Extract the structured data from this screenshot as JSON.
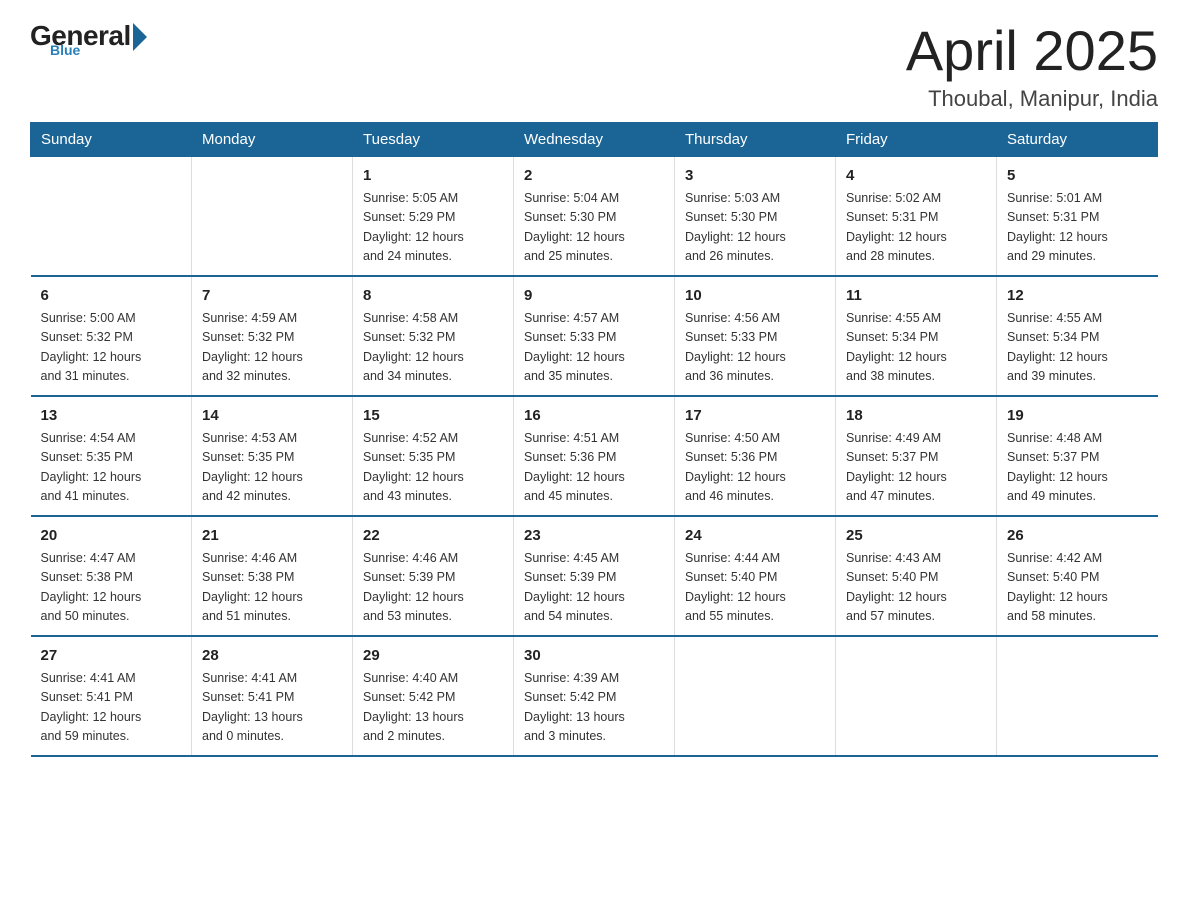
{
  "logo": {
    "general": "General",
    "blue": "Blue",
    "tagline": "Blue"
  },
  "title": "April 2025",
  "subtitle": "Thoubal, Manipur, India",
  "header_days": [
    "Sunday",
    "Monday",
    "Tuesday",
    "Wednesday",
    "Thursday",
    "Friday",
    "Saturday"
  ],
  "weeks": [
    [
      {
        "day": "",
        "info": ""
      },
      {
        "day": "",
        "info": ""
      },
      {
        "day": "1",
        "info": "Sunrise: 5:05 AM\nSunset: 5:29 PM\nDaylight: 12 hours\nand 24 minutes."
      },
      {
        "day": "2",
        "info": "Sunrise: 5:04 AM\nSunset: 5:30 PM\nDaylight: 12 hours\nand 25 minutes."
      },
      {
        "day": "3",
        "info": "Sunrise: 5:03 AM\nSunset: 5:30 PM\nDaylight: 12 hours\nand 26 minutes."
      },
      {
        "day": "4",
        "info": "Sunrise: 5:02 AM\nSunset: 5:31 PM\nDaylight: 12 hours\nand 28 minutes."
      },
      {
        "day": "5",
        "info": "Sunrise: 5:01 AM\nSunset: 5:31 PM\nDaylight: 12 hours\nand 29 minutes."
      }
    ],
    [
      {
        "day": "6",
        "info": "Sunrise: 5:00 AM\nSunset: 5:32 PM\nDaylight: 12 hours\nand 31 minutes."
      },
      {
        "day": "7",
        "info": "Sunrise: 4:59 AM\nSunset: 5:32 PM\nDaylight: 12 hours\nand 32 minutes."
      },
      {
        "day": "8",
        "info": "Sunrise: 4:58 AM\nSunset: 5:32 PM\nDaylight: 12 hours\nand 34 minutes."
      },
      {
        "day": "9",
        "info": "Sunrise: 4:57 AM\nSunset: 5:33 PM\nDaylight: 12 hours\nand 35 minutes."
      },
      {
        "day": "10",
        "info": "Sunrise: 4:56 AM\nSunset: 5:33 PM\nDaylight: 12 hours\nand 36 minutes."
      },
      {
        "day": "11",
        "info": "Sunrise: 4:55 AM\nSunset: 5:34 PM\nDaylight: 12 hours\nand 38 minutes."
      },
      {
        "day": "12",
        "info": "Sunrise: 4:55 AM\nSunset: 5:34 PM\nDaylight: 12 hours\nand 39 minutes."
      }
    ],
    [
      {
        "day": "13",
        "info": "Sunrise: 4:54 AM\nSunset: 5:35 PM\nDaylight: 12 hours\nand 41 minutes."
      },
      {
        "day": "14",
        "info": "Sunrise: 4:53 AM\nSunset: 5:35 PM\nDaylight: 12 hours\nand 42 minutes."
      },
      {
        "day": "15",
        "info": "Sunrise: 4:52 AM\nSunset: 5:35 PM\nDaylight: 12 hours\nand 43 minutes."
      },
      {
        "day": "16",
        "info": "Sunrise: 4:51 AM\nSunset: 5:36 PM\nDaylight: 12 hours\nand 45 minutes."
      },
      {
        "day": "17",
        "info": "Sunrise: 4:50 AM\nSunset: 5:36 PM\nDaylight: 12 hours\nand 46 minutes."
      },
      {
        "day": "18",
        "info": "Sunrise: 4:49 AM\nSunset: 5:37 PM\nDaylight: 12 hours\nand 47 minutes."
      },
      {
        "day": "19",
        "info": "Sunrise: 4:48 AM\nSunset: 5:37 PM\nDaylight: 12 hours\nand 49 minutes."
      }
    ],
    [
      {
        "day": "20",
        "info": "Sunrise: 4:47 AM\nSunset: 5:38 PM\nDaylight: 12 hours\nand 50 minutes."
      },
      {
        "day": "21",
        "info": "Sunrise: 4:46 AM\nSunset: 5:38 PM\nDaylight: 12 hours\nand 51 minutes."
      },
      {
        "day": "22",
        "info": "Sunrise: 4:46 AM\nSunset: 5:39 PM\nDaylight: 12 hours\nand 53 minutes."
      },
      {
        "day": "23",
        "info": "Sunrise: 4:45 AM\nSunset: 5:39 PM\nDaylight: 12 hours\nand 54 minutes."
      },
      {
        "day": "24",
        "info": "Sunrise: 4:44 AM\nSunset: 5:40 PM\nDaylight: 12 hours\nand 55 minutes."
      },
      {
        "day": "25",
        "info": "Sunrise: 4:43 AM\nSunset: 5:40 PM\nDaylight: 12 hours\nand 57 minutes."
      },
      {
        "day": "26",
        "info": "Sunrise: 4:42 AM\nSunset: 5:40 PM\nDaylight: 12 hours\nand 58 minutes."
      }
    ],
    [
      {
        "day": "27",
        "info": "Sunrise: 4:41 AM\nSunset: 5:41 PM\nDaylight: 12 hours\nand 59 minutes."
      },
      {
        "day": "28",
        "info": "Sunrise: 4:41 AM\nSunset: 5:41 PM\nDaylight: 13 hours\nand 0 minutes."
      },
      {
        "day": "29",
        "info": "Sunrise: 4:40 AM\nSunset: 5:42 PM\nDaylight: 13 hours\nand 2 minutes."
      },
      {
        "day": "30",
        "info": "Sunrise: 4:39 AM\nSunset: 5:42 PM\nDaylight: 13 hours\nand 3 minutes."
      },
      {
        "day": "",
        "info": ""
      },
      {
        "day": "",
        "info": ""
      },
      {
        "day": "",
        "info": ""
      }
    ]
  ]
}
